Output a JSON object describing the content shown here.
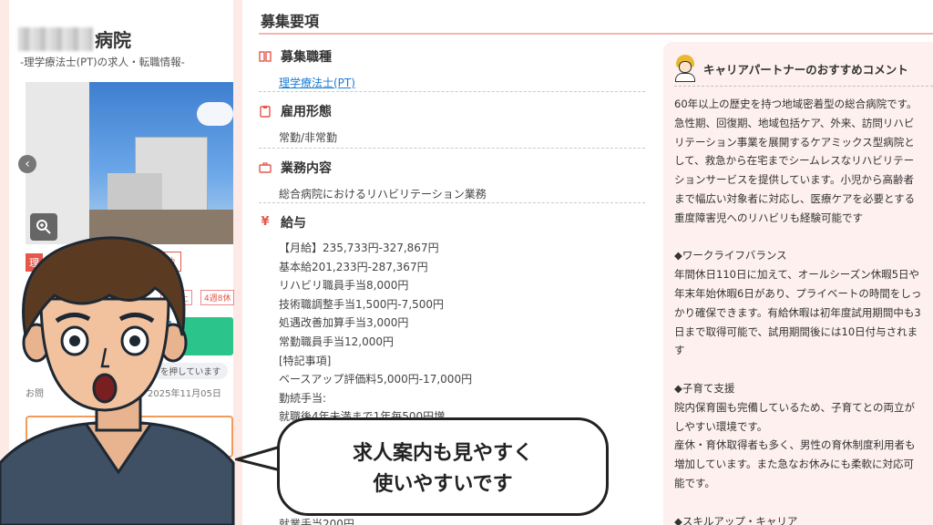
{
  "left_card": {
    "hospital_name_suffix": "病院",
    "subtitle": "-理学療法士(PT)の求人・転職情報-",
    "prev_arrow": "‹",
    "zoom_icon": "magnifier",
    "tag_employment_partial": "理",
    "tag_part_time": "非常勤",
    "tag_small_1": "日以上",
    "tag_small_2": "4週8休",
    "hint_text": "を押しています",
    "date_prefix": "お問",
    "date_text": "2025年11月05日"
  },
  "main": {
    "title": "募集要項",
    "sections": {
      "job_type": {
        "label": "募集職種",
        "value": "理学療法士(PT)"
      },
      "employment": {
        "label": "雇用形態",
        "value": "常勤/非常勤"
      },
      "duties": {
        "label": "業務内容",
        "value": "総合病院におけるリハビリテーション業務"
      },
      "salary": {
        "label": "給与",
        "lines": [
          "【月給】235,733円-327,867円",
          "基本給201,233円-287,367円",
          "リハビリ職員手当8,000円",
          "技術職調整手当1,500円-7,500円",
          "処遇改善加算手当3,000円",
          "常勤職員手当12,000円",
          "[特記事項]",
          "ベースアップ評価料5,000円-17,000円",
          "勤続手当:",
          "就職後4年未満まで1年毎500円増"
        ]
      }
    }
  },
  "panel": {
    "title": "キャリアパートナーのおすすめコメント",
    "body": "60年以上の歴史を持つ地域密着型の総合病院です。\n急性期、回復期、地域包括ケア、外来、訪問リハビ\nリテーション事業を展開するケアミックス型病院と\nして、救急から在宅までシームレスなリハビリテー\nションサービスを提供しています。小児から高齢者\nまで幅広い対象者に対応し、医療ケアを必要とする\n重度障害児へのリハビリも経験可能です\n\n◆ワークライフバランス\n年間休日110日に加えて、オールシーズン休暇5日や\n年末年始休暇6日があり、プライベートの時間をしっ\nかり確保できます。有給休暇は初年度試用期間中も3\n日まで取得可能で、試用期間後には10日付与されま\nす\n\n◆子育て支援\n院内保育園も完備しているため、子育てとの両立が\nしやすい環境です。\n産休・育休取得者も多く、男性の育休制度利用者も\n増加しています。また急なお休みにも柔軟に対応可\n能です。\n\n◆スキルアップ・キャリア"
  },
  "overlay": {
    "bubble_line1": "求人案内も見やすく",
    "bubble_line2": "使いやすいです",
    "bottom_partial": "就業手当200円"
  },
  "colors": {
    "accent_red": "#e4574a",
    "link_blue": "#1a7bd3",
    "page_pink": "#fde9e6",
    "panel_pink": "#fdf0ee",
    "green_button": "#2bc48a"
  }
}
